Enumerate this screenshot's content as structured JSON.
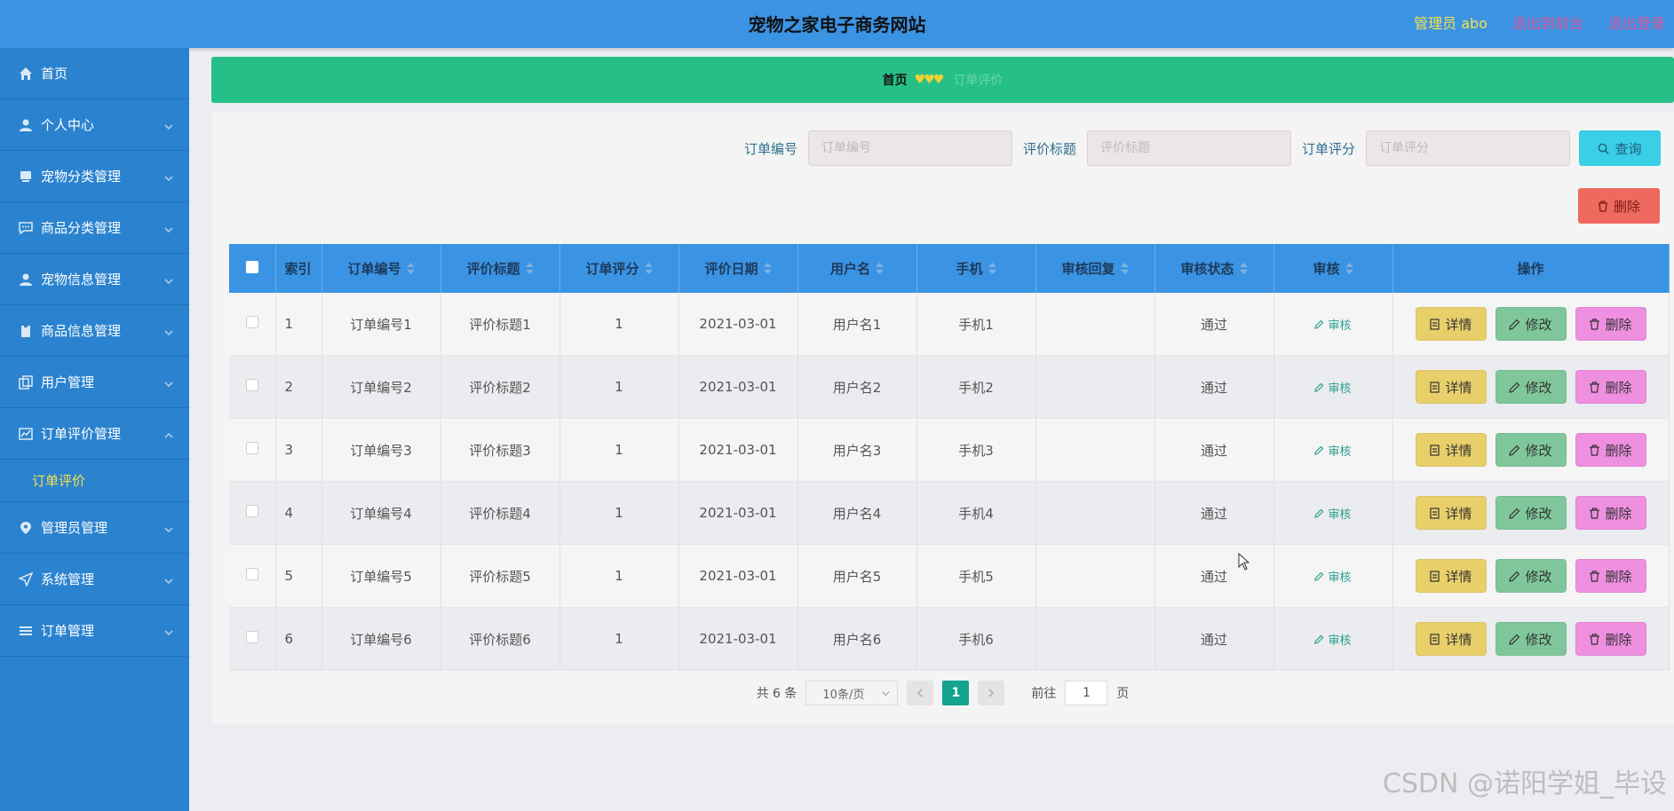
{
  "header": {
    "title": "宠物之家电子商务网站",
    "admin": "管理员 abo",
    "link_front": "退出到前台",
    "link_logout": "退出登录"
  },
  "sidebar": {
    "items": [
      {
        "label": "首页",
        "icon": "home-icon"
      },
      {
        "label": "个人中心",
        "icon": "user-icon"
      },
      {
        "label": "宠物分类管理",
        "icon": "folder-icon"
      },
      {
        "label": "商品分类管理",
        "icon": "chat-icon"
      },
      {
        "label": "宠物信息管理",
        "icon": "user-icon"
      },
      {
        "label": "商品信息管理",
        "icon": "clipboard-icon"
      },
      {
        "label": "用户管理",
        "icon": "copy-icon"
      },
      {
        "label": "订单评价管理",
        "icon": "chart-icon"
      },
      {
        "label": "管理员管理",
        "icon": "location-icon"
      },
      {
        "label": "系统管理",
        "icon": "send-icon"
      },
      {
        "label": "订单管理",
        "icon": "menu-icon"
      }
    ],
    "subitem": "订单评价"
  },
  "breadcrumb": {
    "home": "首页",
    "separator": "♥♥♥",
    "current": "订单评价"
  },
  "search": {
    "fields": [
      {
        "label": "订单编号",
        "placeholder": "订单编号"
      },
      {
        "label": "评价标题",
        "placeholder": "评价标题"
      },
      {
        "label": "订单评分",
        "placeholder": "订单评分"
      }
    ],
    "query_label": "查询",
    "delete_label": "删除"
  },
  "table": {
    "headers": [
      "索引",
      "订单编号",
      "评价标题",
      "订单评分",
      "评价日期",
      "用户名",
      "手机",
      "审核回复",
      "审核状态",
      "审核",
      "操作"
    ],
    "rows": [
      {
        "idx": "1",
        "order_no": "订单编号1",
        "title": "评价标题1",
        "score": "1",
        "date": "2021-03-01",
        "username": "用户名1",
        "phone": "手机1",
        "reply": "",
        "status": "通过"
      },
      {
        "idx": "2",
        "order_no": "订单编号2",
        "title": "评价标题2",
        "score": "1",
        "date": "2021-03-01",
        "username": "用户名2",
        "phone": "手机2",
        "reply": "",
        "status": "通过"
      },
      {
        "idx": "3",
        "order_no": "订单编号3",
        "title": "评价标题3",
        "score": "1",
        "date": "2021-03-01",
        "username": "用户名3",
        "phone": "手机3",
        "reply": "",
        "status": "通过"
      },
      {
        "idx": "4",
        "order_no": "订单编号4",
        "title": "评价标题4",
        "score": "1",
        "date": "2021-03-01",
        "username": "用户名4",
        "phone": "手机4",
        "reply": "",
        "status": "通过"
      },
      {
        "idx": "5",
        "order_no": "订单编号5",
        "title": "评价标题5",
        "score": "1",
        "date": "2021-03-01",
        "username": "用户名5",
        "phone": "手机5",
        "reply": "",
        "status": "通过"
      },
      {
        "idx": "6",
        "order_no": "订单编号6",
        "title": "评价标题6",
        "score": "1",
        "date": "2021-03-01",
        "username": "用户名6",
        "phone": "手机6",
        "reply": "",
        "status": "通过"
      }
    ],
    "audit_label": "审核",
    "detail_label": "详情",
    "edit_label": "修改",
    "delete_label": "删除"
  },
  "pager": {
    "total": "共 6 条",
    "page_size": "10条/页",
    "current_page": "1",
    "goto_prefix": "前往",
    "goto_value": "1",
    "goto_suffix": "页"
  },
  "watermark": "CSDN @诺阳学姐_毕设",
  "colors": {
    "header_bg": "#3b93e3",
    "sidebar_bg": "#2b83cf",
    "breadcrumb_bg": "#27bf88",
    "accent_yellow": "#f5e14a",
    "link_pink": "#e0569a"
  }
}
